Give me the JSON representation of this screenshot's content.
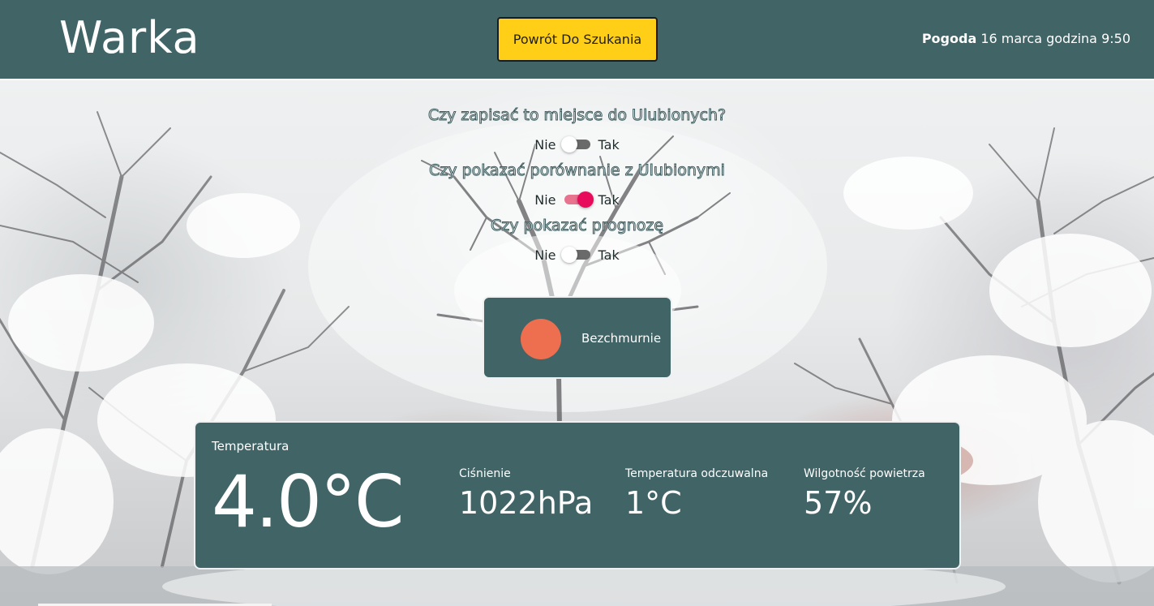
{
  "header": {
    "city": "Warka",
    "back_button": "Powrót Do Szukania",
    "date_bold": "Pogoda",
    "date_rest": " 16 marca godzina 9:50"
  },
  "options": [
    {
      "question": "Czy zapisać to miejsce do Ulubionych?",
      "no": "Nie",
      "yes": "Tak",
      "on": false
    },
    {
      "question": "Czy pokazać porównanie z Ulubionymi",
      "no": "Nie",
      "yes": "Tak",
      "on": true
    },
    {
      "question": "Czy pokazać prognozę",
      "no": "Nie",
      "yes": "Tak",
      "on": false
    }
  ],
  "condition": {
    "icon": "sun-icon",
    "label": "Bezchmurnie",
    "icon_color": "#ee6f4f"
  },
  "details": {
    "temperature_label": "Temperatura",
    "temperature_value": "4.0°C",
    "pressure_label": "Ciśnienie",
    "pressure_value": "1022hPa",
    "feels_like_label": "Temperatura odczuwalna",
    "feels_like_value": "1°C",
    "humidity_label": "Wilgotność powietrza",
    "humidity_value": "57%"
  },
  "colors": {
    "panel": "#416466",
    "accent_button": "#ffcf17",
    "toggle_on": "#e80a5b"
  }
}
